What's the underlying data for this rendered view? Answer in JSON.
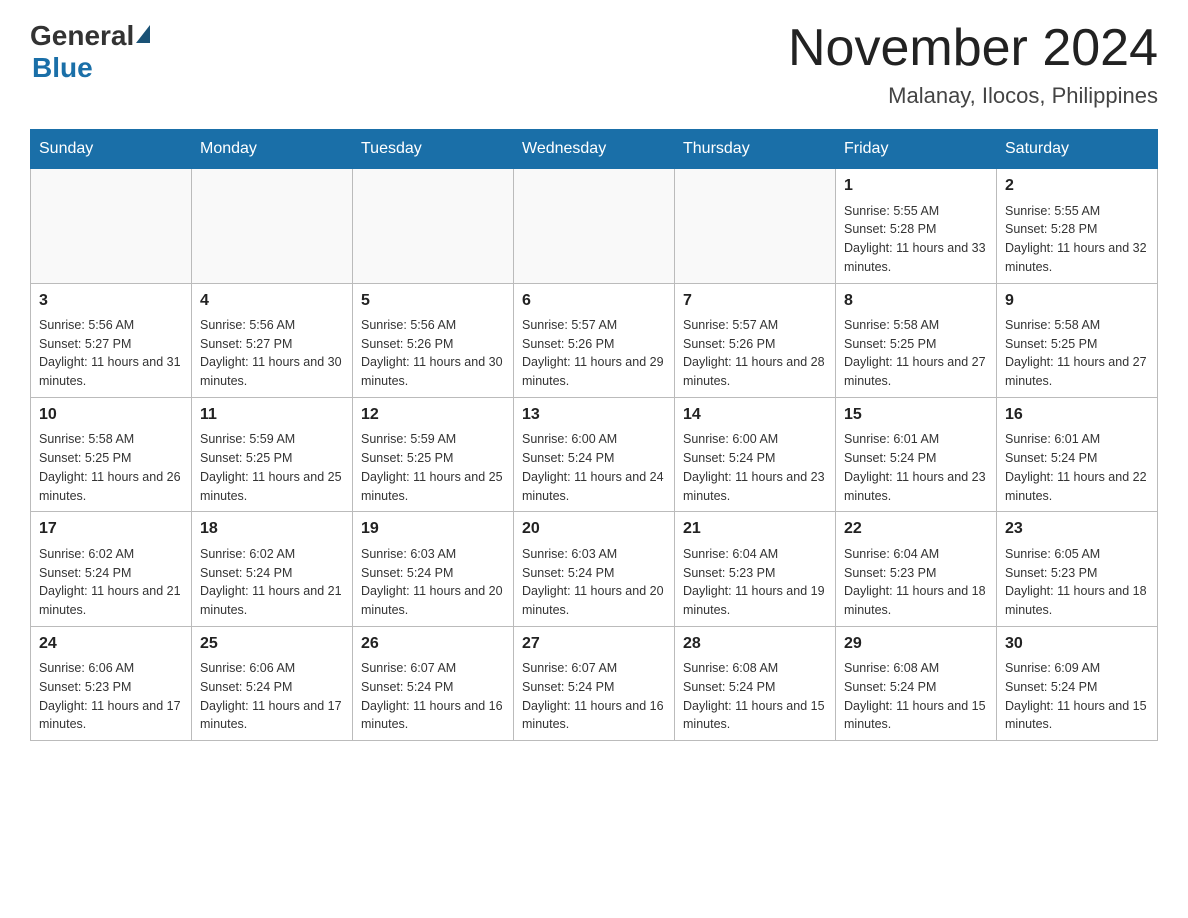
{
  "header": {
    "logo": {
      "general": "General",
      "blue": "Blue"
    },
    "month_title": "November 2024",
    "location": "Malanay, Ilocos, Philippines"
  },
  "calendar": {
    "days_of_week": [
      "Sunday",
      "Monday",
      "Tuesday",
      "Wednesday",
      "Thursday",
      "Friday",
      "Saturday"
    ],
    "weeks": [
      [
        {
          "day": "",
          "info": ""
        },
        {
          "day": "",
          "info": ""
        },
        {
          "day": "",
          "info": ""
        },
        {
          "day": "",
          "info": ""
        },
        {
          "day": "",
          "info": ""
        },
        {
          "day": "1",
          "info": "Sunrise: 5:55 AM\nSunset: 5:28 PM\nDaylight: 11 hours and 33 minutes."
        },
        {
          "day": "2",
          "info": "Sunrise: 5:55 AM\nSunset: 5:28 PM\nDaylight: 11 hours and 32 minutes."
        }
      ],
      [
        {
          "day": "3",
          "info": "Sunrise: 5:56 AM\nSunset: 5:27 PM\nDaylight: 11 hours and 31 minutes."
        },
        {
          "day": "4",
          "info": "Sunrise: 5:56 AM\nSunset: 5:27 PM\nDaylight: 11 hours and 30 minutes."
        },
        {
          "day": "5",
          "info": "Sunrise: 5:56 AM\nSunset: 5:26 PM\nDaylight: 11 hours and 30 minutes."
        },
        {
          "day": "6",
          "info": "Sunrise: 5:57 AM\nSunset: 5:26 PM\nDaylight: 11 hours and 29 minutes."
        },
        {
          "day": "7",
          "info": "Sunrise: 5:57 AM\nSunset: 5:26 PM\nDaylight: 11 hours and 28 minutes."
        },
        {
          "day": "8",
          "info": "Sunrise: 5:58 AM\nSunset: 5:25 PM\nDaylight: 11 hours and 27 minutes."
        },
        {
          "day": "9",
          "info": "Sunrise: 5:58 AM\nSunset: 5:25 PM\nDaylight: 11 hours and 27 minutes."
        }
      ],
      [
        {
          "day": "10",
          "info": "Sunrise: 5:58 AM\nSunset: 5:25 PM\nDaylight: 11 hours and 26 minutes."
        },
        {
          "day": "11",
          "info": "Sunrise: 5:59 AM\nSunset: 5:25 PM\nDaylight: 11 hours and 25 minutes."
        },
        {
          "day": "12",
          "info": "Sunrise: 5:59 AM\nSunset: 5:25 PM\nDaylight: 11 hours and 25 minutes."
        },
        {
          "day": "13",
          "info": "Sunrise: 6:00 AM\nSunset: 5:24 PM\nDaylight: 11 hours and 24 minutes."
        },
        {
          "day": "14",
          "info": "Sunrise: 6:00 AM\nSunset: 5:24 PM\nDaylight: 11 hours and 23 minutes."
        },
        {
          "day": "15",
          "info": "Sunrise: 6:01 AM\nSunset: 5:24 PM\nDaylight: 11 hours and 23 minutes."
        },
        {
          "day": "16",
          "info": "Sunrise: 6:01 AM\nSunset: 5:24 PM\nDaylight: 11 hours and 22 minutes."
        }
      ],
      [
        {
          "day": "17",
          "info": "Sunrise: 6:02 AM\nSunset: 5:24 PM\nDaylight: 11 hours and 21 minutes."
        },
        {
          "day": "18",
          "info": "Sunrise: 6:02 AM\nSunset: 5:24 PM\nDaylight: 11 hours and 21 minutes."
        },
        {
          "day": "19",
          "info": "Sunrise: 6:03 AM\nSunset: 5:24 PM\nDaylight: 11 hours and 20 minutes."
        },
        {
          "day": "20",
          "info": "Sunrise: 6:03 AM\nSunset: 5:24 PM\nDaylight: 11 hours and 20 minutes."
        },
        {
          "day": "21",
          "info": "Sunrise: 6:04 AM\nSunset: 5:23 PM\nDaylight: 11 hours and 19 minutes."
        },
        {
          "day": "22",
          "info": "Sunrise: 6:04 AM\nSunset: 5:23 PM\nDaylight: 11 hours and 18 minutes."
        },
        {
          "day": "23",
          "info": "Sunrise: 6:05 AM\nSunset: 5:23 PM\nDaylight: 11 hours and 18 minutes."
        }
      ],
      [
        {
          "day": "24",
          "info": "Sunrise: 6:06 AM\nSunset: 5:23 PM\nDaylight: 11 hours and 17 minutes."
        },
        {
          "day": "25",
          "info": "Sunrise: 6:06 AM\nSunset: 5:24 PM\nDaylight: 11 hours and 17 minutes."
        },
        {
          "day": "26",
          "info": "Sunrise: 6:07 AM\nSunset: 5:24 PM\nDaylight: 11 hours and 16 minutes."
        },
        {
          "day": "27",
          "info": "Sunrise: 6:07 AM\nSunset: 5:24 PM\nDaylight: 11 hours and 16 minutes."
        },
        {
          "day": "28",
          "info": "Sunrise: 6:08 AM\nSunset: 5:24 PM\nDaylight: 11 hours and 15 minutes."
        },
        {
          "day": "29",
          "info": "Sunrise: 6:08 AM\nSunset: 5:24 PM\nDaylight: 11 hours and 15 minutes."
        },
        {
          "day": "30",
          "info": "Sunrise: 6:09 AM\nSunset: 5:24 PM\nDaylight: 11 hours and 15 minutes."
        }
      ]
    ]
  }
}
